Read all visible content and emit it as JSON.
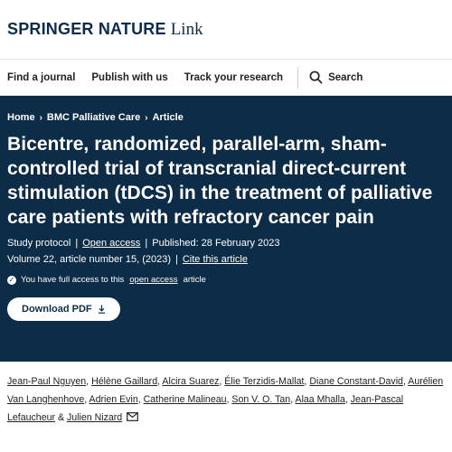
{
  "brand": {
    "name": "SPRINGER NATURE",
    "suffix": "Link"
  },
  "nav": {
    "items": [
      "Find a journal",
      "Publish with us",
      "Track your research"
    ],
    "search_label": "Search"
  },
  "breadcrumbs": [
    "Home",
    "BMC Palliative Care",
    "Article"
  ],
  "article": {
    "title": "Bicentre, randomized, parallel-arm, sham-controlled trial of transcranial direct-current stimulation (tDCS) in the treatment of palliative care patients with refractory cancer pain",
    "type": "Study protocol",
    "open_access": "Open access",
    "published": "Published: 28 February 2023",
    "volume": "Volume 22, article number 15, (2023)",
    "cite": "Cite this article",
    "access_prefix": "You have full access to this",
    "access_link": "open access",
    "access_suffix": "article",
    "download": "Download PDF"
  },
  "authors": [
    "Jean-Paul Nguyen",
    "Hélène Gaillard",
    "Alcira Suarez",
    "Élie Terzidis-Mallat",
    "Diane Constant-David",
    "Aurélien Van Langhenhove",
    "Adrien Evin",
    "Catherine Malineau",
    "Son V. O. Tan",
    "Alaa Mhalla",
    "Jean-Pascal Lefaucheur",
    "Julien Nizard"
  ],
  "colors": {
    "hero_bg": "#0d2c47",
    "brand": "#0b2c4c"
  },
  "icons": {
    "search": "search-icon",
    "download": "download-icon",
    "mail": "mail-icon",
    "check": "check-icon"
  }
}
